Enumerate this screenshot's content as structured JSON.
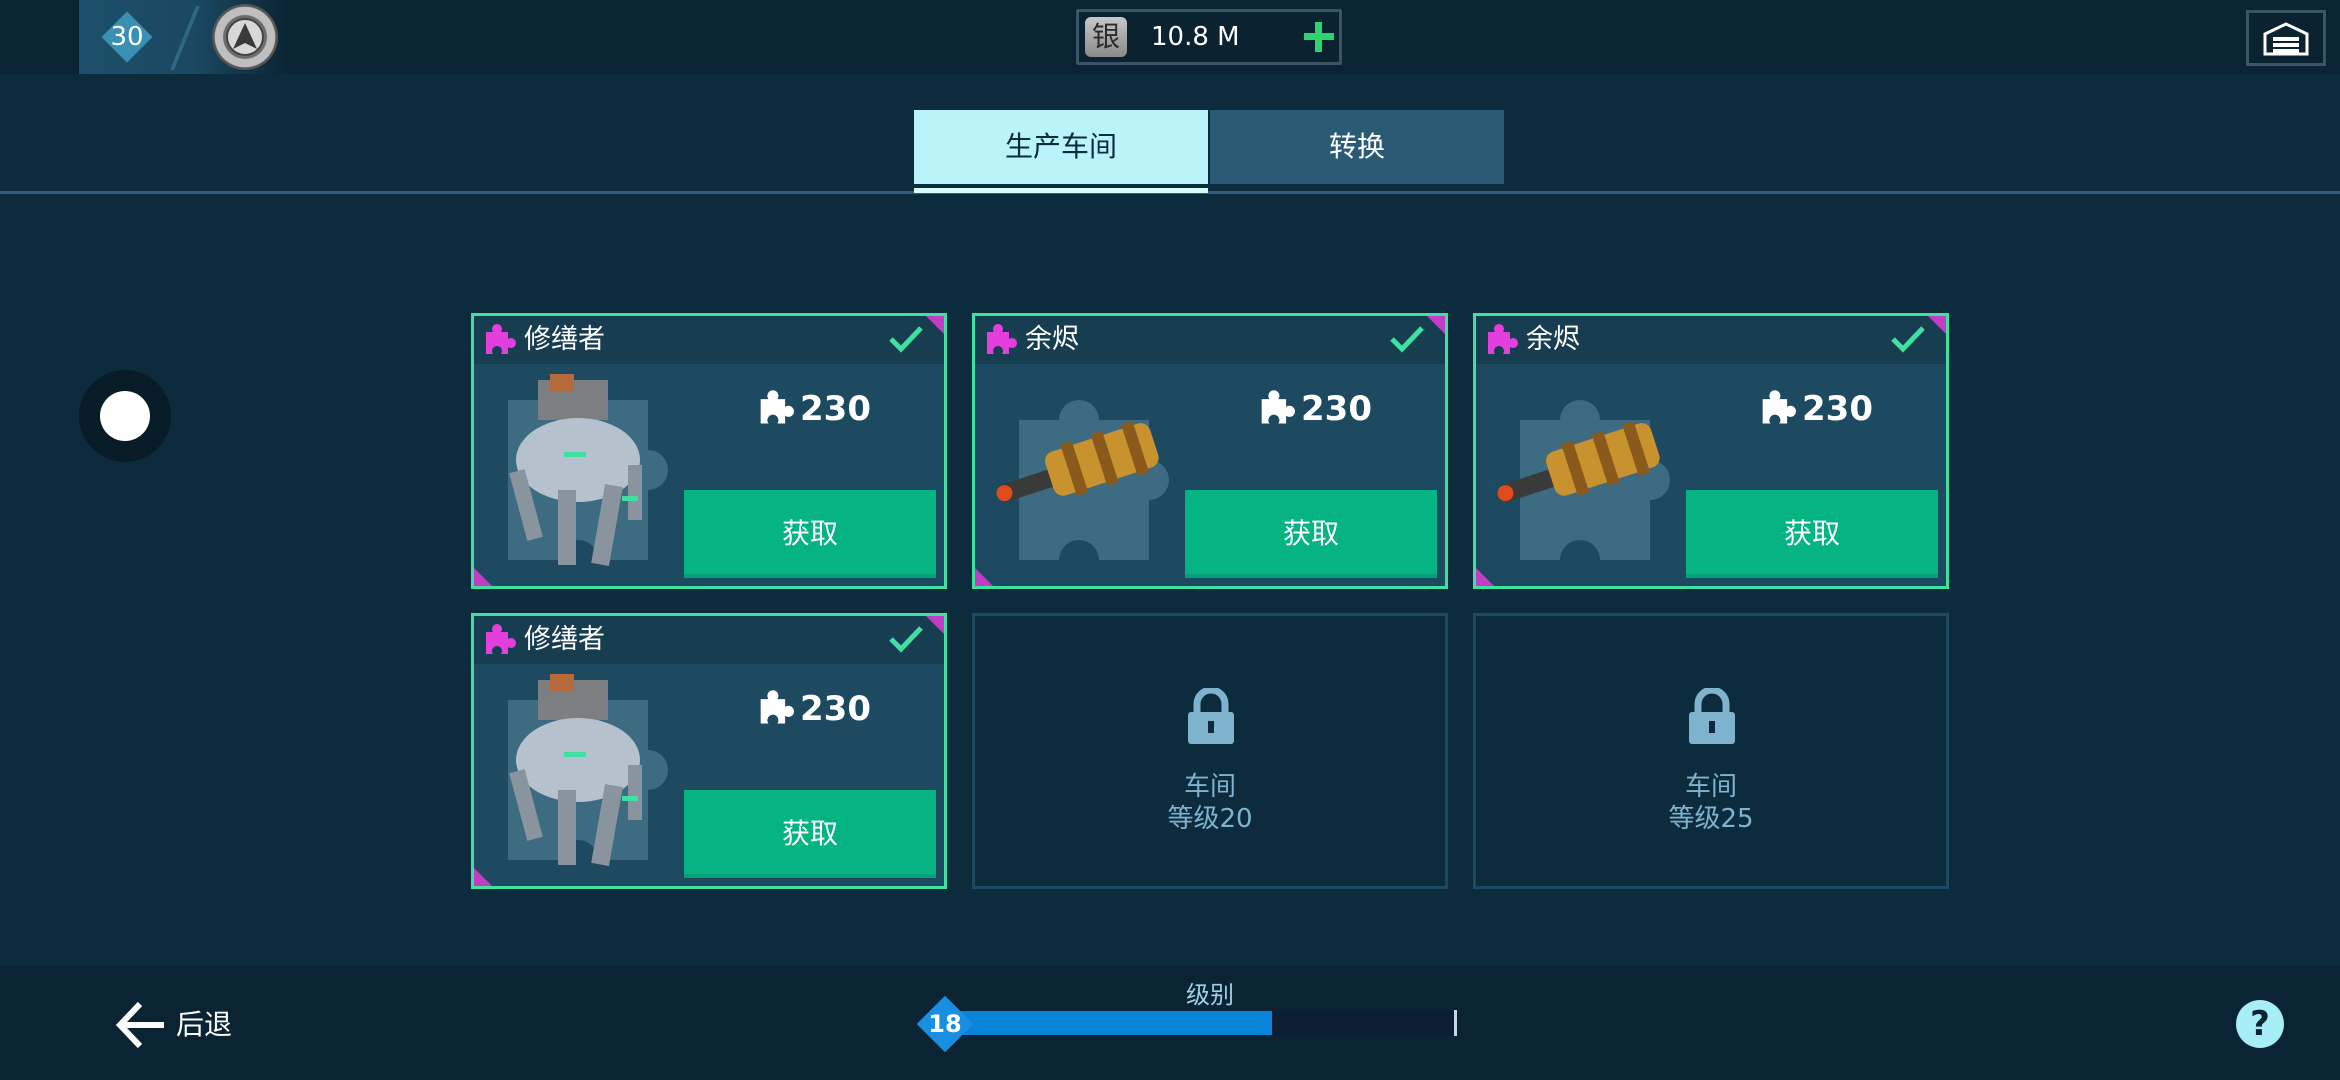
{
  "header": {
    "player_level": "30",
    "currency": {
      "icon_label": "银",
      "amount": "10.8 M"
    }
  },
  "tabs": [
    {
      "label": "生产车间",
      "active": true
    },
    {
      "label": "转换",
      "active": false
    }
  ],
  "slots": [
    {
      "title": "修缮者",
      "cost": "230",
      "button": "获取",
      "art": "robot"
    },
    {
      "title": "余烬",
      "cost": "230",
      "button": "获取",
      "art": "weapon"
    },
    {
      "title": "余烬",
      "cost": "230",
      "button": "获取",
      "art": "weapon"
    },
    {
      "title": "修缮者",
      "cost": "230",
      "button": "获取",
      "art": "robot"
    }
  ],
  "locked_slots": [
    {
      "line1": "车间",
      "line2": "等级20"
    },
    {
      "line1": "车间",
      "line2": "等级25"
    }
  ],
  "footer": {
    "back_label": "后退",
    "level_caption": "级别",
    "workshop_level": "18",
    "progress_fraction": 0.64,
    "help_label": "?"
  },
  "colors": {
    "background": "#0c2b3d",
    "card_border": "#3fe0a0",
    "button": "#06b383",
    "rarity_corner": "#c23cc4",
    "progress": "#0a84d8"
  }
}
